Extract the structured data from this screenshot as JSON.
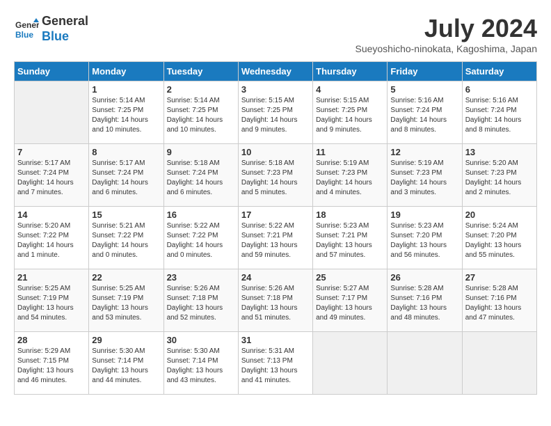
{
  "header": {
    "logo_line1": "General",
    "logo_line2": "Blue",
    "month": "July 2024",
    "location": "Sueyoshicho-ninokata, Kagoshima, Japan"
  },
  "weekdays": [
    "Sunday",
    "Monday",
    "Tuesday",
    "Wednesday",
    "Thursday",
    "Friday",
    "Saturday"
  ],
  "weeks": [
    [
      {
        "day": "",
        "sunrise": "",
        "sunset": "",
        "daylight": ""
      },
      {
        "day": "1",
        "sunrise": "Sunrise: 5:14 AM",
        "sunset": "Sunset: 7:25 PM",
        "daylight": "Daylight: 14 hours and 10 minutes."
      },
      {
        "day": "2",
        "sunrise": "Sunrise: 5:14 AM",
        "sunset": "Sunset: 7:25 PM",
        "daylight": "Daylight: 14 hours and 10 minutes."
      },
      {
        "day": "3",
        "sunrise": "Sunrise: 5:15 AM",
        "sunset": "Sunset: 7:25 PM",
        "daylight": "Daylight: 14 hours and 9 minutes."
      },
      {
        "day": "4",
        "sunrise": "Sunrise: 5:15 AM",
        "sunset": "Sunset: 7:25 PM",
        "daylight": "Daylight: 14 hours and 9 minutes."
      },
      {
        "day": "5",
        "sunrise": "Sunrise: 5:16 AM",
        "sunset": "Sunset: 7:24 PM",
        "daylight": "Daylight: 14 hours and 8 minutes."
      },
      {
        "day": "6",
        "sunrise": "Sunrise: 5:16 AM",
        "sunset": "Sunset: 7:24 PM",
        "daylight": "Daylight: 14 hours and 8 minutes."
      }
    ],
    [
      {
        "day": "7",
        "sunrise": "Sunrise: 5:17 AM",
        "sunset": "Sunset: 7:24 PM",
        "daylight": "Daylight: 14 hours and 7 minutes."
      },
      {
        "day": "8",
        "sunrise": "Sunrise: 5:17 AM",
        "sunset": "Sunset: 7:24 PM",
        "daylight": "Daylight: 14 hours and 6 minutes."
      },
      {
        "day": "9",
        "sunrise": "Sunrise: 5:18 AM",
        "sunset": "Sunset: 7:24 PM",
        "daylight": "Daylight: 14 hours and 6 minutes."
      },
      {
        "day": "10",
        "sunrise": "Sunrise: 5:18 AM",
        "sunset": "Sunset: 7:23 PM",
        "daylight": "Daylight: 14 hours and 5 minutes."
      },
      {
        "day": "11",
        "sunrise": "Sunrise: 5:19 AM",
        "sunset": "Sunset: 7:23 PM",
        "daylight": "Daylight: 14 hours and 4 minutes."
      },
      {
        "day": "12",
        "sunrise": "Sunrise: 5:19 AM",
        "sunset": "Sunset: 7:23 PM",
        "daylight": "Daylight: 14 hours and 3 minutes."
      },
      {
        "day": "13",
        "sunrise": "Sunrise: 5:20 AM",
        "sunset": "Sunset: 7:23 PM",
        "daylight": "Daylight: 14 hours and 2 minutes."
      }
    ],
    [
      {
        "day": "14",
        "sunrise": "Sunrise: 5:20 AM",
        "sunset": "Sunset: 7:22 PM",
        "daylight": "Daylight: 14 hours and 1 minute."
      },
      {
        "day": "15",
        "sunrise": "Sunrise: 5:21 AM",
        "sunset": "Sunset: 7:22 PM",
        "daylight": "Daylight: 14 hours and 0 minutes."
      },
      {
        "day": "16",
        "sunrise": "Sunrise: 5:22 AM",
        "sunset": "Sunset: 7:22 PM",
        "daylight": "Daylight: 14 hours and 0 minutes."
      },
      {
        "day": "17",
        "sunrise": "Sunrise: 5:22 AM",
        "sunset": "Sunset: 7:21 PM",
        "daylight": "Daylight: 13 hours and 59 minutes."
      },
      {
        "day": "18",
        "sunrise": "Sunrise: 5:23 AM",
        "sunset": "Sunset: 7:21 PM",
        "daylight": "Daylight: 13 hours and 57 minutes."
      },
      {
        "day": "19",
        "sunrise": "Sunrise: 5:23 AM",
        "sunset": "Sunset: 7:20 PM",
        "daylight": "Daylight: 13 hours and 56 minutes."
      },
      {
        "day": "20",
        "sunrise": "Sunrise: 5:24 AM",
        "sunset": "Sunset: 7:20 PM",
        "daylight": "Daylight: 13 hours and 55 minutes."
      }
    ],
    [
      {
        "day": "21",
        "sunrise": "Sunrise: 5:25 AM",
        "sunset": "Sunset: 7:19 PM",
        "daylight": "Daylight: 13 hours and 54 minutes."
      },
      {
        "day": "22",
        "sunrise": "Sunrise: 5:25 AM",
        "sunset": "Sunset: 7:19 PM",
        "daylight": "Daylight: 13 hours and 53 minutes."
      },
      {
        "day": "23",
        "sunrise": "Sunrise: 5:26 AM",
        "sunset": "Sunset: 7:18 PM",
        "daylight": "Daylight: 13 hours and 52 minutes."
      },
      {
        "day": "24",
        "sunrise": "Sunrise: 5:26 AM",
        "sunset": "Sunset: 7:18 PM",
        "daylight": "Daylight: 13 hours and 51 minutes."
      },
      {
        "day": "25",
        "sunrise": "Sunrise: 5:27 AM",
        "sunset": "Sunset: 7:17 PM",
        "daylight": "Daylight: 13 hours and 49 minutes."
      },
      {
        "day": "26",
        "sunrise": "Sunrise: 5:28 AM",
        "sunset": "Sunset: 7:16 PM",
        "daylight": "Daylight: 13 hours and 48 minutes."
      },
      {
        "day": "27",
        "sunrise": "Sunrise: 5:28 AM",
        "sunset": "Sunset: 7:16 PM",
        "daylight": "Daylight: 13 hours and 47 minutes."
      }
    ],
    [
      {
        "day": "28",
        "sunrise": "Sunrise: 5:29 AM",
        "sunset": "Sunset: 7:15 PM",
        "daylight": "Daylight: 13 hours and 46 minutes."
      },
      {
        "day": "29",
        "sunrise": "Sunrise: 5:30 AM",
        "sunset": "Sunset: 7:14 PM",
        "daylight": "Daylight: 13 hours and 44 minutes."
      },
      {
        "day": "30",
        "sunrise": "Sunrise: 5:30 AM",
        "sunset": "Sunset: 7:14 PM",
        "daylight": "Daylight: 13 hours and 43 minutes."
      },
      {
        "day": "31",
        "sunrise": "Sunrise: 5:31 AM",
        "sunset": "Sunset: 7:13 PM",
        "daylight": "Daylight: 13 hours and 41 minutes."
      },
      {
        "day": "",
        "sunrise": "",
        "sunset": "",
        "daylight": ""
      },
      {
        "day": "",
        "sunrise": "",
        "sunset": "",
        "daylight": ""
      },
      {
        "day": "",
        "sunrise": "",
        "sunset": "",
        "daylight": ""
      }
    ]
  ]
}
